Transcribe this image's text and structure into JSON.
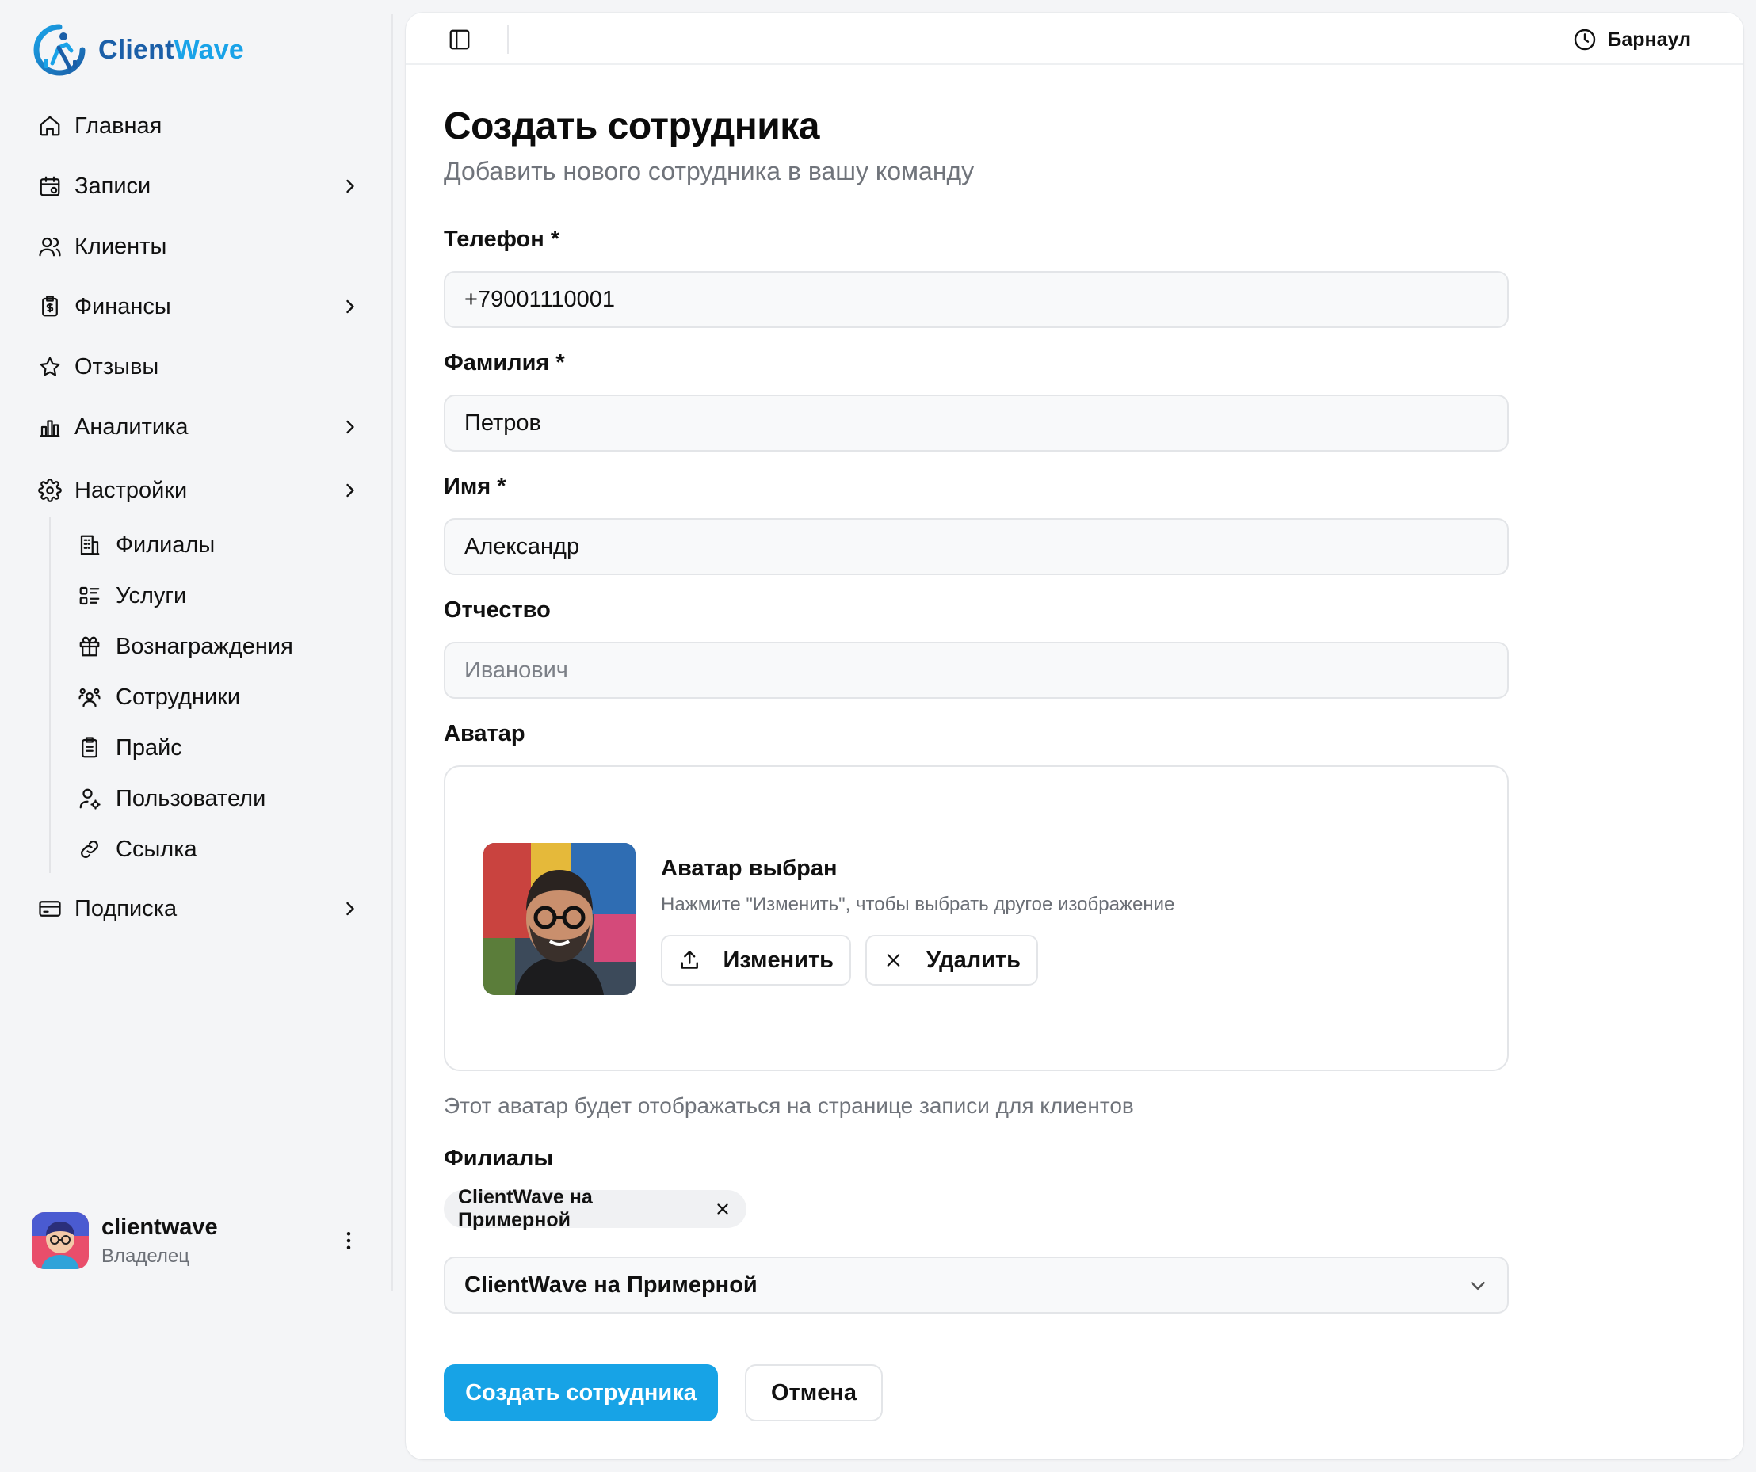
{
  "brand": {
    "name_part1": "Client",
    "name_part2": "Wave",
    "color_dark": "#1b5fa8",
    "color_accent": "#1aa3e8"
  },
  "sidebar": {
    "items": [
      {
        "label": "Главная",
        "icon": "home-icon",
        "has_submenu": false
      },
      {
        "label": "Записи",
        "icon": "calendar-icon",
        "has_submenu": true
      },
      {
        "label": "Клиенты",
        "icon": "users-icon",
        "has_submenu": false
      },
      {
        "label": "Финансы",
        "icon": "finance-icon",
        "has_submenu": true
      },
      {
        "label": "Отзывы",
        "icon": "star-icon",
        "has_submenu": false
      },
      {
        "label": "Аналитика",
        "icon": "bar-chart-icon",
        "has_submenu": true
      },
      {
        "label": "Настройки",
        "icon": "gear-icon",
        "has_submenu": true,
        "expanded": true
      }
    ],
    "settings_sub": [
      {
        "label": "Филиалы",
        "icon": "building-icon"
      },
      {
        "label": "Услуги",
        "icon": "list-icon"
      },
      {
        "label": "Вознаграждения",
        "icon": "gift-icon"
      },
      {
        "label": "Сотрудники",
        "icon": "team-icon"
      },
      {
        "label": "Прайс",
        "icon": "clipboard-icon"
      },
      {
        "label": "Пользователи",
        "icon": "user-cog-icon"
      },
      {
        "label": "Ссылка",
        "icon": "link-icon"
      }
    ],
    "subscription": {
      "label": "Подписка",
      "icon": "card-icon",
      "has_submenu": true
    },
    "user": {
      "name": "clientwave",
      "role": "Владелец"
    }
  },
  "topbar": {
    "city": "Барнаул"
  },
  "form": {
    "title": "Создать сотрудника",
    "subtitle": "Добавить нового сотрудника в вашу команду",
    "phone": {
      "label": "Телефон *",
      "value": "+79001110001"
    },
    "last_name": {
      "label": "Фамилия *",
      "value": "Петров"
    },
    "first_name": {
      "label": "Имя *",
      "value": "Александр"
    },
    "middle_name": {
      "label": "Отчество",
      "value": "",
      "placeholder": "Иванович"
    },
    "avatar": {
      "label": "Аватар",
      "title": "Аватар выбран",
      "hint": "Нажмите \"Изменить\", чтобы выбрать другое изображение",
      "change_label": "Изменить",
      "delete_label": "Удалить",
      "helper": "Этот аватар будет отображаться на странице записи для клиентов"
    },
    "branches": {
      "label": "Филиалы",
      "chips": [
        "ClientWave на Примерной"
      ],
      "selected": "ClientWave на Примерной"
    },
    "submit_label": "Создать сотрудника",
    "cancel_label": "Отмена",
    "primary_color": "#17a3e6"
  }
}
